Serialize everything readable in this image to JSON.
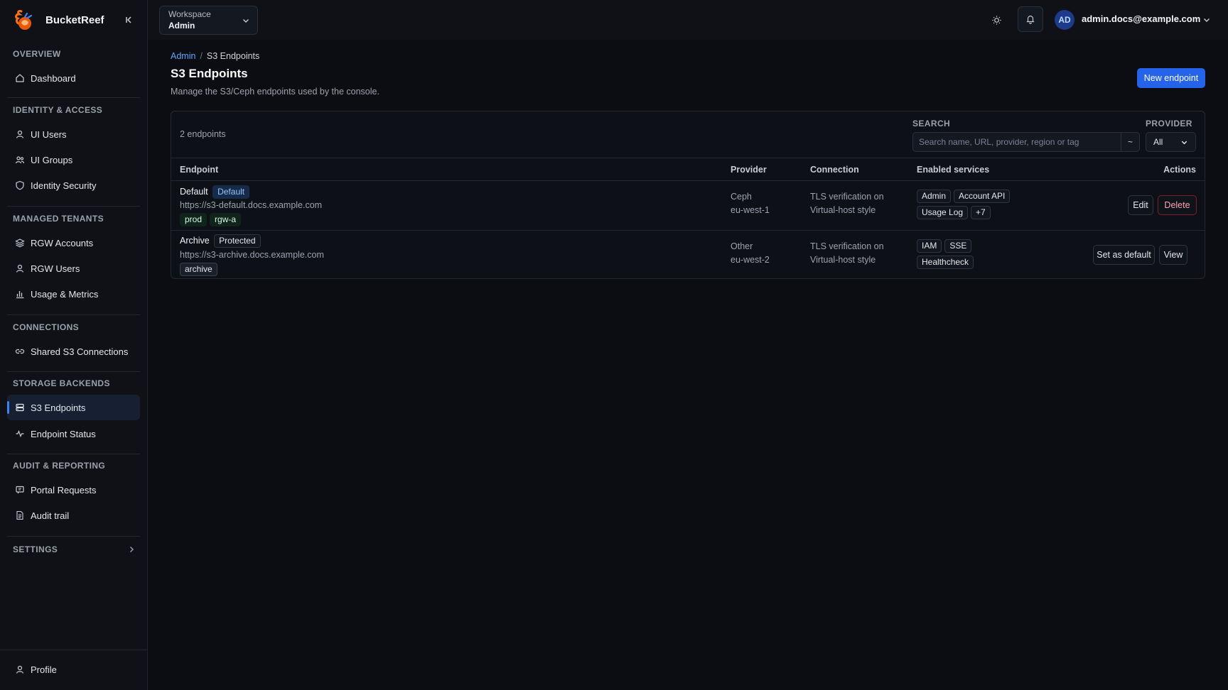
{
  "app": {
    "name": "BucketReef"
  },
  "sidebar": {
    "sections": {
      "overview": {
        "title": "OVERVIEW",
        "items": [
          "Dashboard"
        ]
      },
      "identity": {
        "title": "IDENTITY & ACCESS",
        "items": [
          "UI Users",
          "UI Groups",
          "Identity Security"
        ]
      },
      "tenants": {
        "title": "MANAGED TENANTS",
        "items": [
          "RGW Accounts",
          "RGW Users",
          "Usage & Metrics"
        ]
      },
      "connections": {
        "title": "CONNECTIONS",
        "items": [
          "Shared S3 Connections"
        ]
      },
      "storage": {
        "title": "STORAGE BACKENDS",
        "items": [
          "S3 Endpoints",
          "Endpoint Status"
        ]
      },
      "audit": {
        "title": "AUDIT & REPORTING",
        "items": [
          "Portal Requests",
          "Audit trail"
        ]
      }
    },
    "settings_label": "SETTINGS",
    "profile_label": "Profile",
    "active_item": "S3 Endpoints"
  },
  "header": {
    "workspace_label": "Workspace",
    "workspace_value": "Admin",
    "avatar_initials": "AD",
    "user_email": "admin.docs@example.com"
  },
  "page": {
    "breadcrumb": [
      "Admin",
      "/",
      "S3 Endpoints"
    ],
    "title": "S3 Endpoints",
    "subtitle": "Manage the S3/Ceph endpoints used by the console.",
    "new_button": "New endpoint"
  },
  "table": {
    "count_text": "2 endpoints",
    "search_label": "SEARCH",
    "search_placeholder": "Search name, URL, provider, region or tag",
    "search_clear": "~",
    "provider_label": "PROVIDER",
    "provider_value": "All",
    "columns": [
      "Endpoint",
      "Provider",
      "Connection",
      "Enabled services",
      "Actions"
    ],
    "rows": [
      {
        "name": "Default",
        "badge": "Default",
        "url": "https://s3-default.docs.example.com",
        "tags": [
          "prod",
          "rgw-a"
        ],
        "provider": "Ceph",
        "region": "eu-west-1",
        "tls": "TLS verification on",
        "style": "Virtual-host style",
        "services": [
          "Admin",
          "Account API",
          "Usage Log",
          "+7"
        ],
        "actions": [
          "Edit",
          "Delete"
        ]
      },
      {
        "name": "Archive",
        "badge": "Protected",
        "url": "https://s3-archive.docs.example.com",
        "tags": [
          "archive"
        ],
        "provider": "Other",
        "region": "eu-west-2",
        "tls": "TLS verification on",
        "style": "Virtual-host style",
        "services": [
          "IAM",
          "SSE",
          "Healthcheck"
        ],
        "actions": [
          "Set as default",
          "View"
        ]
      }
    ]
  },
  "colors": {
    "accent": "#2563eb",
    "background": "#0b0d12",
    "sidebar": "#0f1117",
    "danger": "#7f1d2d"
  }
}
